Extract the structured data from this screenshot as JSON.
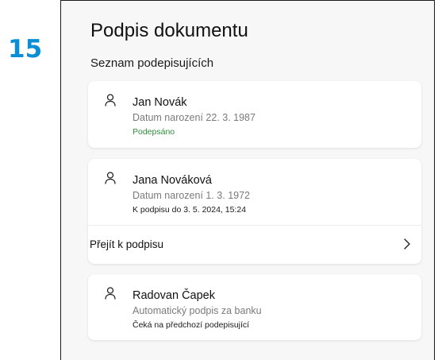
{
  "step": {
    "number": "15"
  },
  "page": {
    "title": "Podpis dokumentu",
    "section_title": "Seznam podepisujících"
  },
  "signers": [
    {
      "name": "Jan Novák",
      "info": "Datum narození 22. 3. 1987",
      "status": "Podepsáno",
      "status_color": "#2e8b3a",
      "icon": "person-icon"
    },
    {
      "name": "Jana Nováková",
      "info": "Datum narození 1. 3. 1972",
      "status": "K podpisu do 3. 5. 2024, 15:24",
      "icon": "person-icon",
      "action_label": "Přejít k podpisu",
      "action_icon": "chevron-right-icon"
    },
    {
      "name": "Radovan Čapek",
      "info": "Automatický podpis za banku",
      "status": "Čeká na předchozí podepisující",
      "icon": "person-icon"
    }
  ],
  "colors": {
    "step_number": "#0a8fd6",
    "background": "#f7f7f7",
    "card": "#ffffff",
    "status_done": "#2e8b3a"
  }
}
